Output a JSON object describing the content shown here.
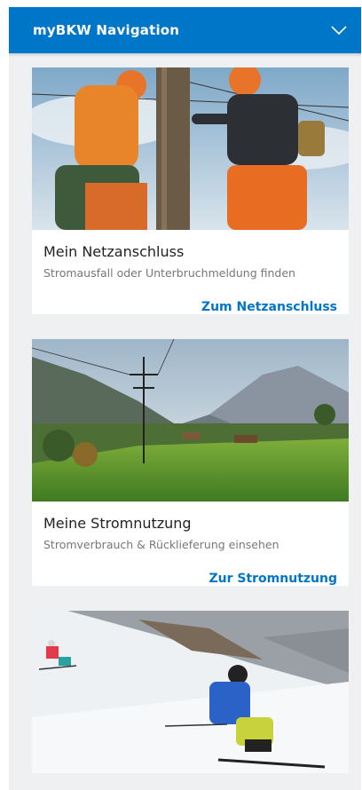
{
  "nav": {
    "title": "myBKW Navigation",
    "toggle_icon": "chevron-down-icon"
  },
  "cards": [
    {
      "title": "Mein Netzanschluss",
      "subtitle": "Stromausfall oder Unterbruchmeldung finden",
      "link": "Zum Netzanschluss",
      "image": "linemen-on-pole-photo"
    },
    {
      "title": "Meine Stromnutzung",
      "subtitle": "Stromverbrauch & Rücklieferung einsehen",
      "link": "Zur Stromnutzung",
      "image": "power-line-valley-photo"
    },
    {
      "image": "skiers-on-slope-photo"
    }
  ],
  "colors": {
    "brand": "#0076c8",
    "background": "#eef0f2"
  }
}
